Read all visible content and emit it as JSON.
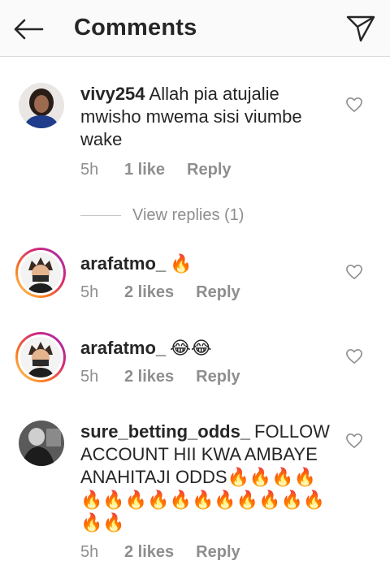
{
  "header": {
    "title": "Comments"
  },
  "comments": [
    {
      "username": "vivy254",
      "text": "Allah pia atujalie mwisho mwema sisi viumbe wake",
      "time": "5h",
      "likes": "1 like",
      "reply": "Reply",
      "avatar": "profile-photo-woman",
      "view_replies": "View replies (1)"
    },
    {
      "username": "arafatmo_",
      "text": "🔥",
      "time": "5h",
      "likes": "2 likes",
      "reply": "Reply",
      "avatar": "cartoon-avatar-story-ring"
    },
    {
      "username": "arafatmo_",
      "text": "😂😂",
      "time": "5h",
      "likes": "2 likes",
      "reply": "Reply",
      "avatar": "cartoon-avatar-story-ring"
    },
    {
      "username": "sure_betting_odds_",
      "text": "FOLLOW ACCOUNT HII KWA AMBAYE ANAHITAJI ODDS🔥🔥🔥🔥🔥🔥🔥🔥🔥🔥🔥🔥🔥🔥🔥🔥🔥",
      "time": "5h",
      "likes": "2 likes",
      "reply": "Reply",
      "avatar": "grayscale-photo"
    }
  ],
  "colors": {
    "text": "#262626",
    "secondary": "#8e8e8e",
    "header_bg": "#fafafa"
  },
  "icons": [
    "back-arrow-icon",
    "send-icon",
    "heart-outline-icon"
  ]
}
